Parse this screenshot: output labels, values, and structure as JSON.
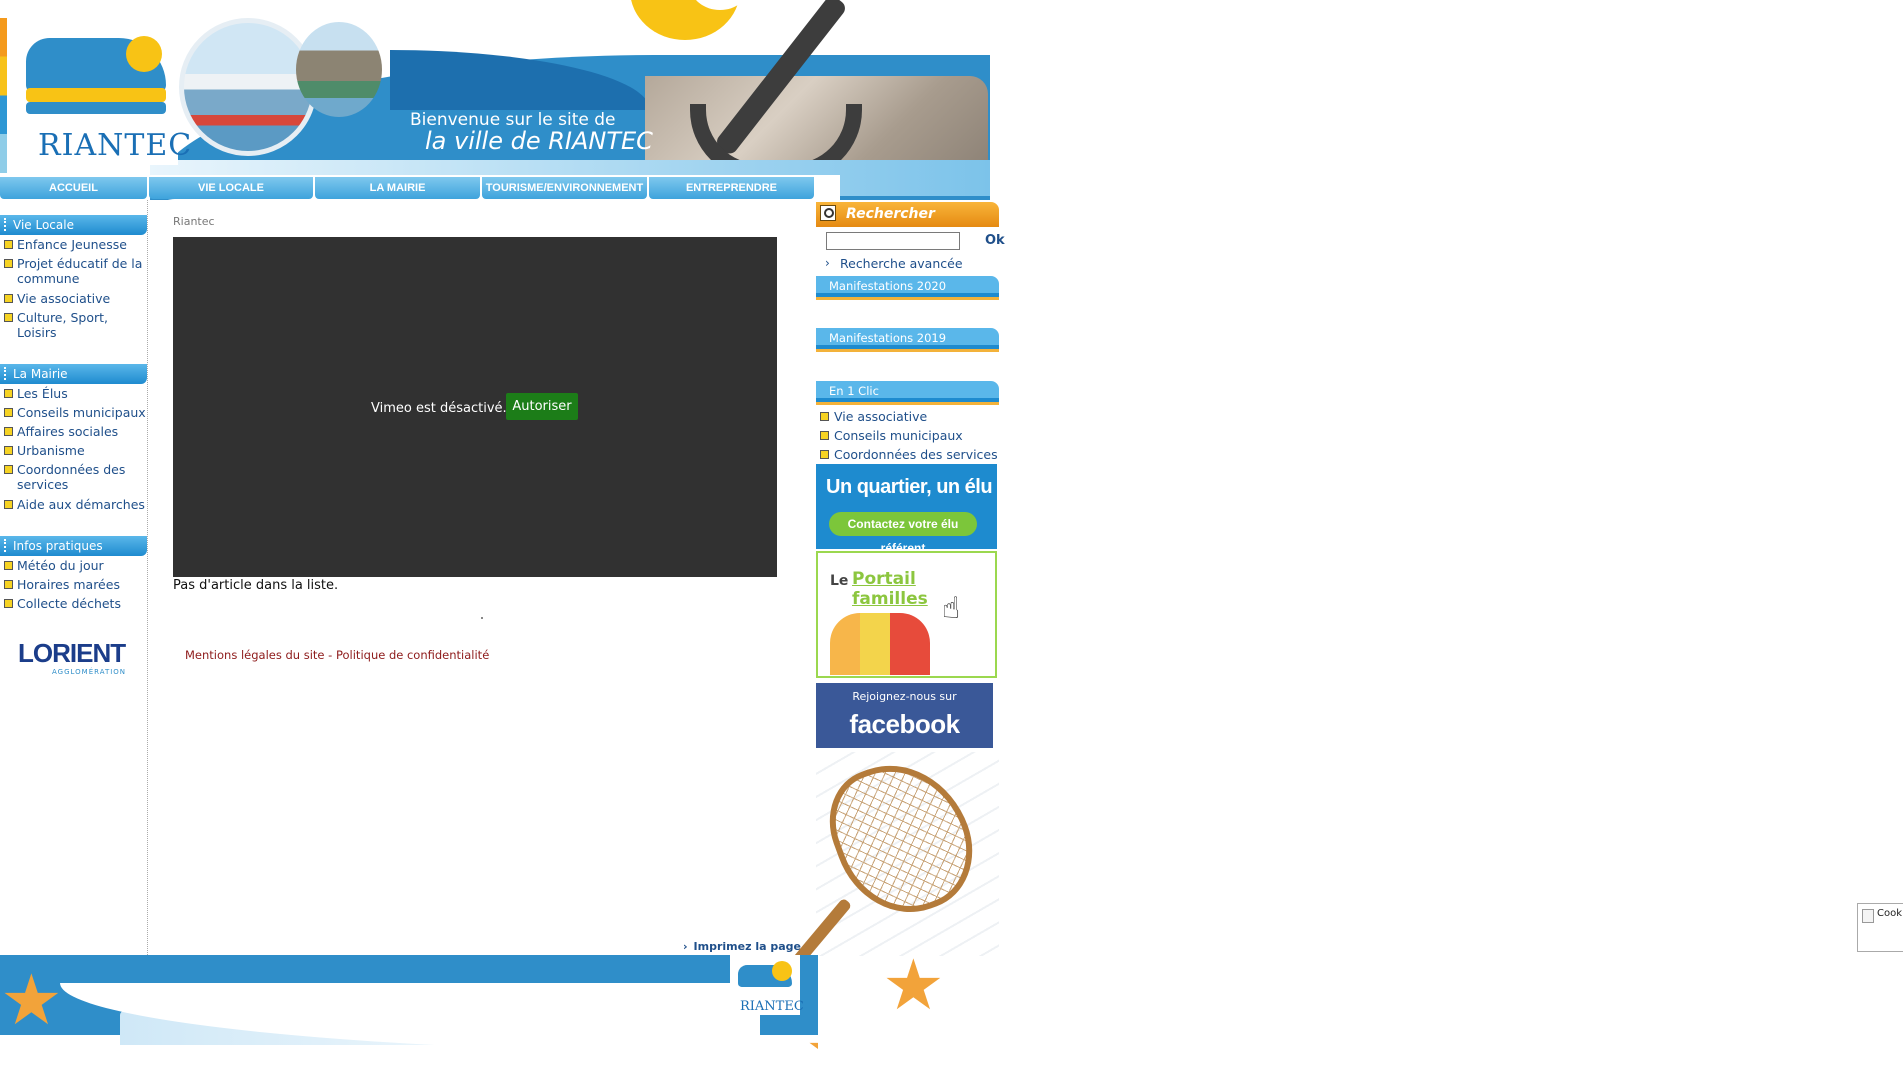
{
  "header": {
    "welcome_line1": "Bienvenue sur le site de",
    "welcome_line2": "la ville de RIANTEC",
    "logo_text": "RIANTEC"
  },
  "nav": {
    "items": [
      "ACCUEIL",
      "VIE LOCALE",
      "LA MAIRIE",
      "TOURISME/ENVIRONNEMENT",
      "ENTREPRENDRE"
    ]
  },
  "sidebar": {
    "sections": [
      {
        "title": "Vie Locale",
        "items": [
          "Enfance Jeunesse",
          "Projet éducatif de la commune",
          "Vie associative",
          "Culture, Sport, Loisirs"
        ]
      },
      {
        "title": "La Mairie",
        "items": [
          "Les Élus",
          "Conseils municipaux",
          "Affaires sociales",
          "Urbanisme",
          "Coordonnées des services",
          "Aide aux démarches"
        ]
      },
      {
        "title": "Infos pratiques",
        "items": [
          "Météo du jour",
          "Horaires marées",
          "Collecte déchets"
        ]
      }
    ],
    "lorient_logo": {
      "name": "LORIENT",
      "subtitle": "AGGLOMÉRATION"
    }
  },
  "main": {
    "breadcrumb": "Riantec",
    "vimeo_message": "Vimeo est désactivé.",
    "vimeo_button": "Autoriser",
    "empty_list": "Pas d'article dans la liste.",
    "legal_link": "Mentions légales du site",
    "legal_separator": "-",
    "privacy_link": "Politique de confidentialité",
    "print_link": "Imprimez la page"
  },
  "rightcol": {
    "search_title": "Rechercher",
    "search_value": "",
    "search_button": "Ok",
    "advanced_search": "Recherche avancée",
    "box_titles": [
      "Manifestations 2020",
      "Manifestations 2019",
      "En 1 Clic"
    ],
    "quick_links": [
      "Vie associative",
      "Conseils municipaux",
      "Coordonnées des services"
    ],
    "quartier_title": "Un quartier, un élu",
    "quartier_button": "Contactez votre élu référent",
    "portail_le": "Le",
    "portail_title": "Portail familles",
    "facebook_line1": "Rejoignez-nous sur",
    "facebook_line2": "facebook"
  },
  "footer": {
    "logo_text": "RIANTEC"
  },
  "cookie_widget": {
    "label": "Cook"
  }
}
